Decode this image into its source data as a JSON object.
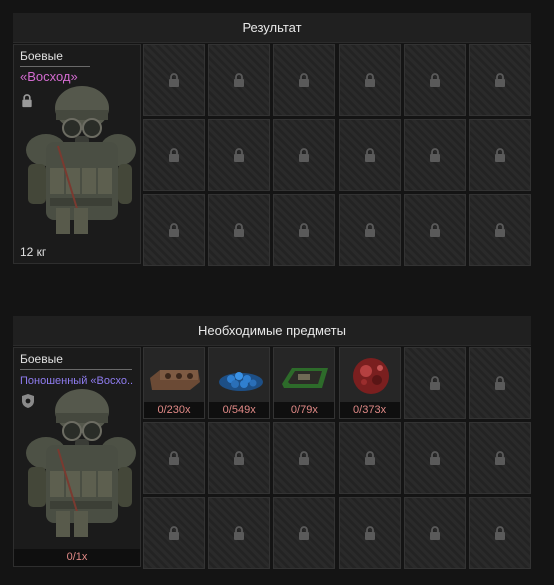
{
  "result": {
    "header": "Результат",
    "card": {
      "category": "Боевые",
      "name": "«Восход»",
      "weight": "12 кг"
    }
  },
  "required": {
    "header": "Необходимые предметы",
    "card": {
      "category": "Боевые",
      "name": "Поношенный «Восхо..",
      "count": "0/1x"
    },
    "items": [
      {
        "qty": "0/230x",
        "icon": "brick-part-icon"
      },
      {
        "qty": "0/549x",
        "icon": "blue-crystals-icon"
      },
      {
        "qty": "0/79x",
        "icon": "circuit-board-icon"
      },
      {
        "qty": "0/373x",
        "icon": "red-orb-icon"
      }
    ]
  },
  "colors": {
    "rarity_name": "#d36bd0",
    "worn_name": "#8f7cf0",
    "count_text": "#e28a87"
  }
}
